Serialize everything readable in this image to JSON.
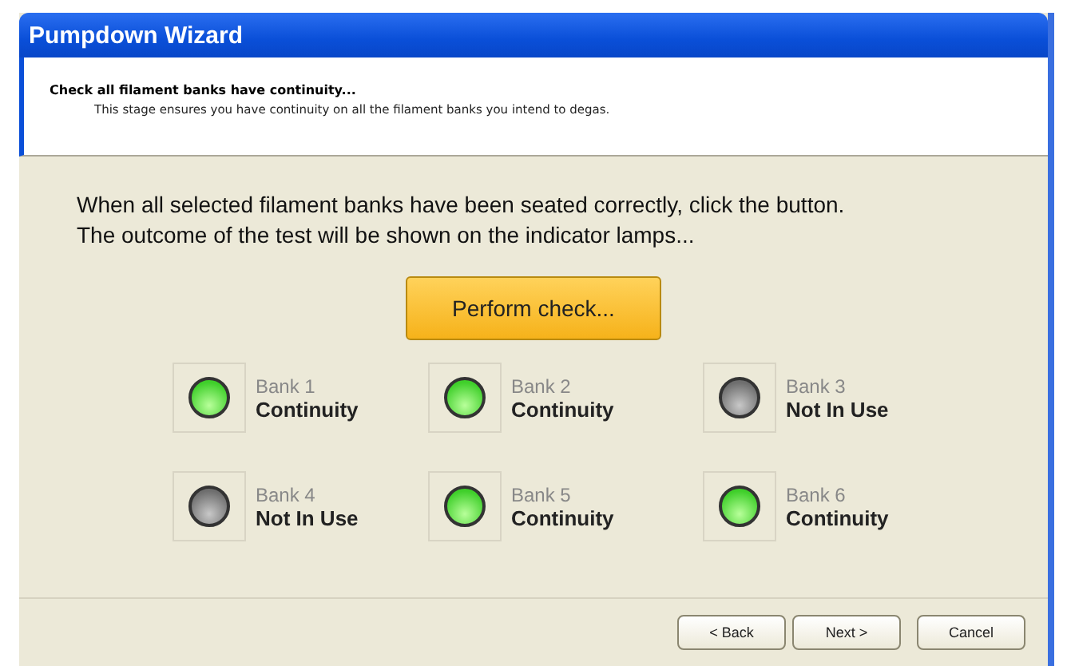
{
  "window": {
    "title": "Pumpdown Wizard"
  },
  "header": {
    "title": "Check all filament banks have continuity...",
    "subtitle": "This stage ensures you have continuity on all the filament banks you intend to degas."
  },
  "instructions": [
    "When all selected filament banks have been seated correctly, click the button.",
    "The outcome of the test will be shown on the indicator lamps..."
  ],
  "check_button": "Perform check...",
  "banks": [
    {
      "name": "Bank 1",
      "status": "Continuity",
      "lit": true
    },
    {
      "name": "Bank 2",
      "status": "Continuity",
      "lit": true
    },
    {
      "name": "Bank 3",
      "status": "Not In Use",
      "lit": false
    },
    {
      "name": "Bank 4",
      "status": "Not In Use",
      "lit": false
    },
    {
      "name": "Bank 5",
      "status": "Continuity",
      "lit": true
    },
    {
      "name": "Bank 6",
      "status": "Continuity",
      "lit": true
    }
  ],
  "buttons": [
    "< Back",
    "Next >",
    "Cancel"
  ]
}
